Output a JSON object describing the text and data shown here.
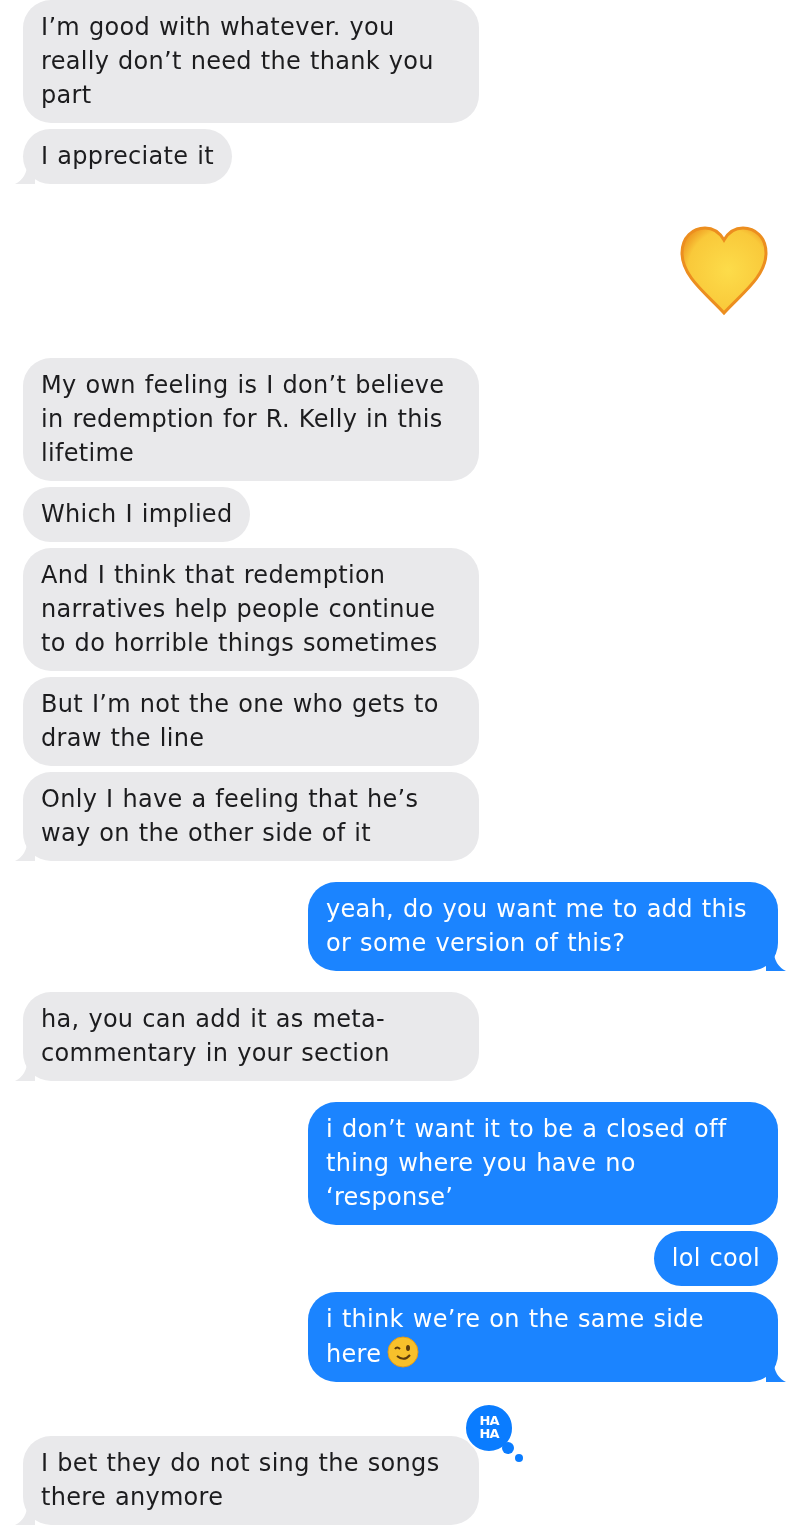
{
  "groups": [
    {
      "outgoing": false,
      "kind": "text",
      "messages": [
        {
          "text": "I’m good with whatever.  you really don’t need the thank you part"
        },
        {
          "text": "I appreciate it"
        }
      ]
    },
    {
      "outgoing": true,
      "kind": "heart"
    },
    {
      "outgoing": false,
      "kind": "text",
      "messages": [
        {
          "text": "My own feeling is I don’t believe in redemption for R. Kelly in this lifetime"
        },
        {
          "text": "Which I implied"
        },
        {
          "text": "And I think that redemption narratives help people continue to do horrible things sometimes"
        },
        {
          "text": "But I’m not the one who gets to draw the line"
        },
        {
          "text": "Only I have a feeling that he’s way on the other side of it"
        }
      ]
    },
    {
      "outgoing": true,
      "kind": "text",
      "messages": [
        {
          "text": "yeah, do you want me to add this or some version of this?"
        }
      ]
    },
    {
      "outgoing": false,
      "kind": "text",
      "messages": [
        {
          "text": "ha, you can add it as meta-commentary in your section"
        }
      ]
    },
    {
      "outgoing": true,
      "kind": "text",
      "messages": [
        {
          "text": "i don’t want it to be a closed off thing where you have no ‘response’"
        },
        {
          "text": "lol cool"
        },
        {
          "text": "i think we’re on the same side here",
          "winking_emoji": true
        }
      ]
    },
    {
      "outgoing": false,
      "kind": "text",
      "messages": [
        {
          "text": "I bet they do not sing the songs there anymore",
          "tapback": "HA HA"
        }
      ]
    }
  ]
}
